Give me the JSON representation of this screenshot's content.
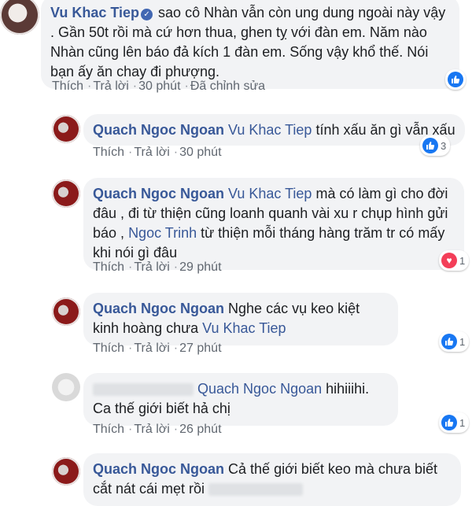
{
  "actions": {
    "like": "Thích",
    "reply": "Trả lời",
    "edited": "Đã chỉnh sửa"
  },
  "comments": [
    {
      "author": "Vu Khac Tiep",
      "text": "sao cô Nhàn vẫn còn ung dung ngoài này vậy . Gần 50t rồi mà cứ hơn thua, ghen tỵ với đàn em. Năm nào Nhàn cũng lên báo đả kích 1 đàn em. Sống vậy khổ thế. Nói bạn ấy ăn chay đi phượng.",
      "time": "30 phút",
      "reaction": "like",
      "reaction_count": ""
    },
    {
      "author": "Quach Ngoc Ngoan",
      "tag": "Vu Khac Tiep",
      "text": "tính xấu ăn gì vẫn xấu",
      "time": "30 phút",
      "reaction": "like",
      "reaction_count": "3"
    },
    {
      "author": "Quach Ngoc Ngoan",
      "tag": "Vu Khac Tiep",
      "text1": "mà có làm gì cho đời đâu , đi từ thiện cũng loanh quanh vài xu r chụp hình gửi báo ,",
      "tag2": "Ngoc Trinh",
      "text2": "từ thiện mỗi tháng hàng trăm tr có mấy khi nói gì đâu",
      "time": "29 phút",
      "reaction": "heart",
      "reaction_count": "1"
    },
    {
      "author": "Quach Ngoc Ngoan",
      "text": "Nghe các vụ keo kiệt kinh hoàng chưa",
      "tag": "Vu Khac Tiep",
      "time": "27 phút",
      "reaction": "like",
      "reaction_count": "1"
    },
    {
      "tag": "Quach Ngoc Ngoan",
      "text": "hihiiihi. Ca thế giới biết hả chị",
      "time": "26 phút",
      "reaction": "like",
      "reaction_count": "1"
    },
    {
      "author": "Quach Ngoc Ngoan",
      "text": "Cả thế giới biết keo mà chưa biết cắt nát cái mẹt rồi"
    }
  ]
}
